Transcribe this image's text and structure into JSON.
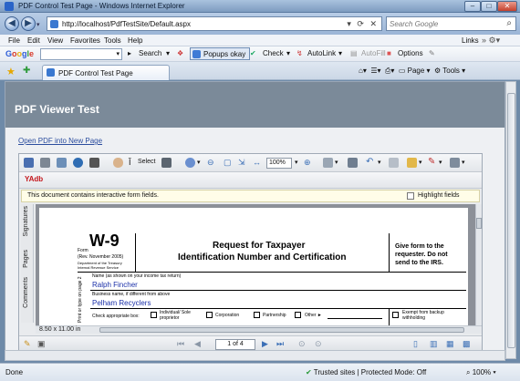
{
  "window": {
    "title": "PDF Control Test Page - Windows Internet Explorer",
    "minimize": "–",
    "maximize": "□",
    "close": "✕"
  },
  "address_bar": {
    "url": "http://localhost/PdfTestSite/Default.aspx",
    "search_placeholder": "Search Google"
  },
  "menu": {
    "items": [
      "File",
      "Edit",
      "View",
      "Favorites",
      "Tools",
      "Help"
    ],
    "links": "Links"
  },
  "google_toolbar": {
    "logo": [
      "G",
      "o",
      "o",
      "g",
      "l",
      "e"
    ],
    "search_label": "Search",
    "popups": "Popups okay",
    "check": "Check",
    "autolink": "AutoLink",
    "autofill": "AutoFill",
    "options": "Options"
  },
  "tabs": {
    "active": "PDF Control Test Page"
  },
  "command_bar": {
    "page": "Page",
    "tools": "Tools"
  },
  "page": {
    "header": "PDF Viewer Test",
    "open_link": "Open PDF into New Page"
  },
  "viewer": {
    "select_label": "Select",
    "zoom": "100%",
    "message": "This document contains interactive form fields.",
    "highlight_label": "Highlight fields",
    "side_tabs": [
      "Signatures",
      "Pages",
      "Comments"
    ],
    "page_size": "8.50 x 11.00 in",
    "page_indicator": "1 of 4",
    "adobe_label": "YAdb"
  },
  "w9": {
    "form_label": "Form",
    "form_number": "W-9",
    "rev": "(Rev. November 2005)",
    "dept": "Department of the Treasury",
    "irs": "Internal Revenue Service",
    "title_line1": "Request for Taxpayer",
    "title_line2": "Identification Number and Certification",
    "right_note": "Give form to the requester. Do not send to the IRS.",
    "name_label": "Name (as shown on your income tax return)",
    "name_value": "Ralph Fincher",
    "business_label": "Business name, if different from above",
    "business_value": "Pelham Recyclers",
    "side_label": "Print or type on page 2",
    "check_label": "Check appropriate box:",
    "individual": "Individual/ Sole proprietor",
    "corporation": "Corporation",
    "partnership": "Partnership",
    "other": "Other ►",
    "exempt": "Exempt from backup withholding"
  },
  "status": {
    "done": "Done",
    "zone": "Trusted sites | Protected Mode: Off",
    "zoom": "100%"
  }
}
